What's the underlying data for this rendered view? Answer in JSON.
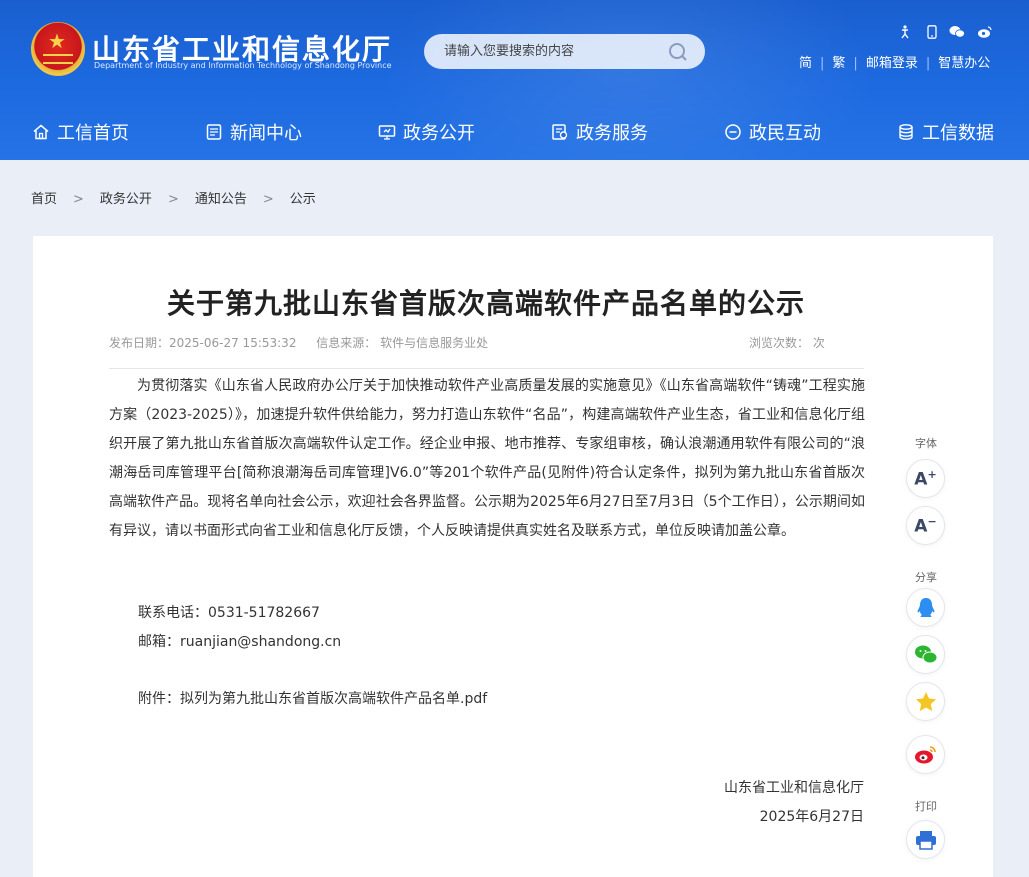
{
  "header": {
    "site_title": "山东省工业和信息化厅",
    "site_subtitle": "Department of Industry and Information Technology of Shandong Province",
    "search_placeholder": "请输入您要搜索的内容",
    "top_links": [
      "简",
      "繁",
      "邮箱登录",
      "智慧办公"
    ]
  },
  "nav": {
    "items": [
      {
        "label": "工信首页",
        "icon": "home-icon"
      },
      {
        "label": "新闻中心",
        "icon": "news-icon"
      },
      {
        "label": "政务公开",
        "icon": "gov-open-icon"
      },
      {
        "label": "政务服务",
        "icon": "gov-service-icon"
      },
      {
        "label": "政民互动",
        "icon": "interaction-icon"
      },
      {
        "label": "工信数据",
        "icon": "database-icon"
      }
    ]
  },
  "breadcrumb": [
    "首页",
    "政务公开",
    "通知公告",
    "公示"
  ],
  "breadcrumb_sep": ">",
  "article": {
    "title": "关于第九批山东省首版次高端软件产品名单的公示",
    "publish_date": "发布日期：2025-06-27 15:53:32",
    "source": "信息来源： 软件与信息服务业处",
    "views": "浏览次数：      次",
    "body": "为贯彻落实《山东省人民政府办公厅关于加快推动软件产业高质量发展的实施意见》《山东省高端软件“铸魂”工程实施方案（2023-2025）》，加速提升软件供给能力，努力打造山东软件“名品”，构建高端软件产业生态，省工业和信息化厅组织开展了第九批山东省首版次高端软件认定工作。经企业申报、地市推荐、专家组审核，确认浪潮通用软件有限公司的“浪潮海岳司库管理平台[简称浪潮海岳司库管理]V6.0”等201个软件产品(见附件)符合认定条件，拟列为第九批山东省首版次高端软件产品。现将名单向社会公示，欢迎社会各界监督。公示期为2025年6月27日至7月3日（5个工作日），公示期间如有异议，请以书面形式向省工业和信息化厅反馈，个人反映请提供真实姓名及联系方式，单位反映请加盖公章。",
    "phone": "联系电话：0531-51782667",
    "email": "邮箱：ruanjian@shandong.cn",
    "attachment_prefix": "附件：",
    "attachment_name": "拟列为第九批山东省首版次高端软件产品名单.pdf",
    "signature": "山东省工业和信息化厅",
    "sign_date": "2025年6月27日"
  },
  "side_tools": {
    "font_label": "字体",
    "share_label": "分享",
    "print_label": "打印",
    "font_increase": "A",
    "font_decrease": "A"
  },
  "colors": {
    "header_blue": "#1d6ae0",
    "page_bg": "#e9eef7"
  }
}
